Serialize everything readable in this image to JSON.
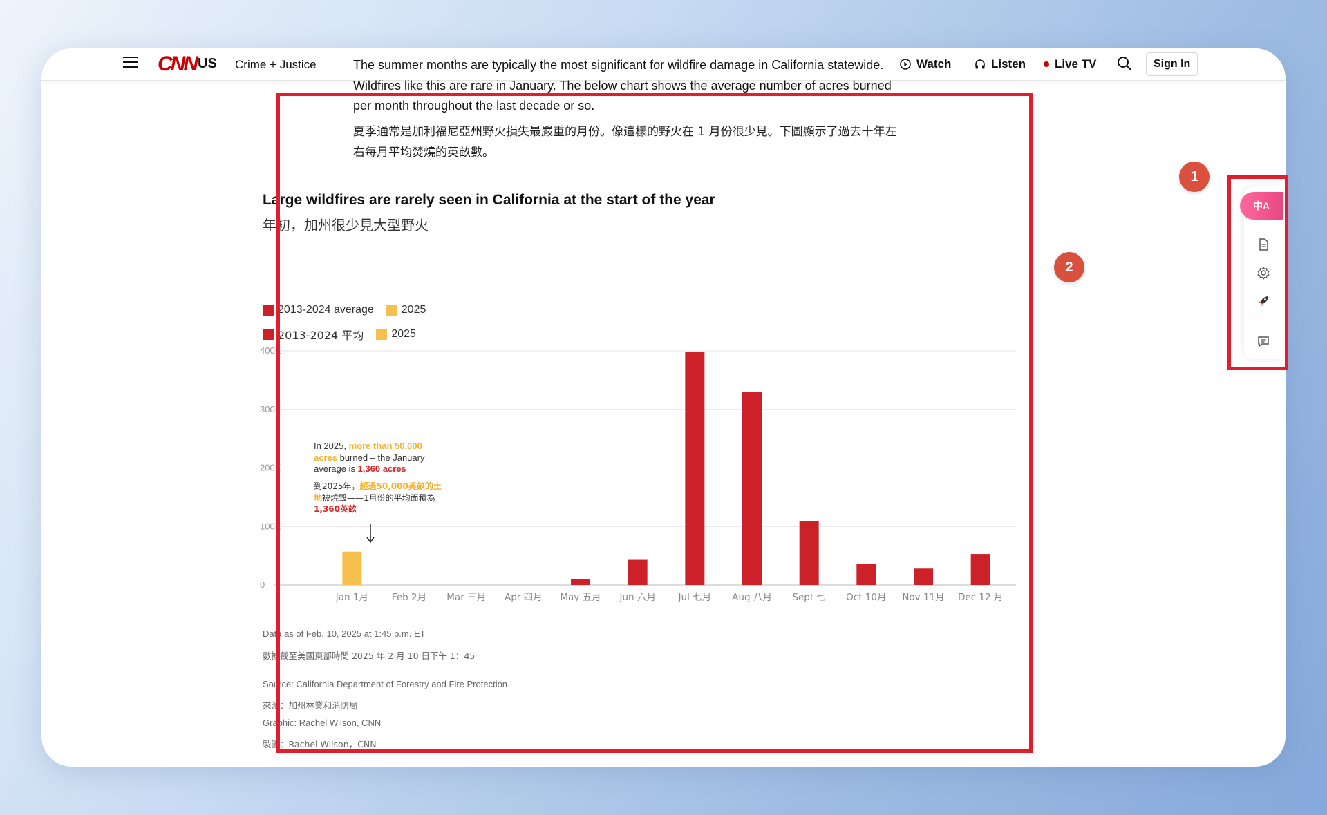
{
  "header": {
    "edition": "US",
    "section": "Crime + Justice",
    "watch": "Watch",
    "listen": "Listen",
    "live_tv": "Live TV",
    "sign_in": "Sign In"
  },
  "article": {
    "paragraph_en": "The summer months are typically the most significant for wildfire damage in California statewide. Wildfires like this are rare in January. The below chart shows the average number of acres burned per month throughout the last decade or so.",
    "paragraph_zh": "夏季通常是加利福尼亞州野火損失最嚴重的月份。像這樣的野火在 1 月份很少見。下圖顯示了過去十年左右每月平均焚燒的英畝數。"
  },
  "chart_data": {
    "type": "bar",
    "title": "Large wildfires are rarely seen in California at the start of the year",
    "subtitle": "年初，加州很少見大型野火",
    "legend_en": [
      "2013-2024 average",
      "2025"
    ],
    "legend_zh": [
      "2013-2024 平均",
      "2025"
    ],
    "categories": [
      "Jan 1月",
      "Feb 2月",
      "Mar 三月",
      "Apr 四月",
      "May 五月",
      "Jun 六月",
      "Jul 七月",
      "Aug 八月",
      "Sept 七",
      "Oct 10月",
      "Nov 11月",
      "Dec 12 月"
    ],
    "series": [
      {
        "name": "2013-2024 average",
        "color": "#cc2128",
        "values": [
          1360,
          800,
          900,
          1500,
          10000,
          43000,
          398000,
          330000,
          109000,
          36000,
          28000,
          53000
        ]
      },
      {
        "name": "2025",
        "color": "#f6c04f",
        "values": [
          57000,
          null,
          null,
          null,
          null,
          null,
          null,
          null,
          null,
          null,
          null,
          null
        ]
      }
    ],
    "ylim": [
      0,
      400000
    ],
    "y_ticks": [
      0,
      100000,
      200000,
      300000,
      400000
    ],
    "y_tick_labels": [
      "0",
      "100K",
      "200K",
      "300K",
      "400K"
    ],
    "grid": true,
    "annotation_en": {
      "prefix": "In 2025, ",
      "highlight_orange": "more than 50,000 acres",
      "middle": " burned – the January average is ",
      "highlight_red": "1,360 acres"
    },
    "annotation_zh": {
      "prefix": "到2025年，",
      "highlight_orange": "超過50,000英畝的土地",
      "middle": "被燒毀——1月份的平均面積為",
      "highlight_red": "1,360英畝"
    }
  },
  "footnotes": {
    "data_as_of_en": "Data as of Feb. 10, 2025 at 1:45 p.m. ET",
    "data_as_of_zh": "數據截至美國東部時間 2025 年 2 月 10 日下午 1：45",
    "source_en": "Source: California Department of Forestry and Fire Protection",
    "source_zh": "來源：加州林業和消防局",
    "graphic_en": "Graphic: Rachel Wilson, CNN",
    "graphic_zh": "製圖：Rachel Wilson，CNN"
  },
  "badges": {
    "one": "1",
    "two": "2"
  },
  "toolbar": {
    "translate_label": "中A"
  }
}
